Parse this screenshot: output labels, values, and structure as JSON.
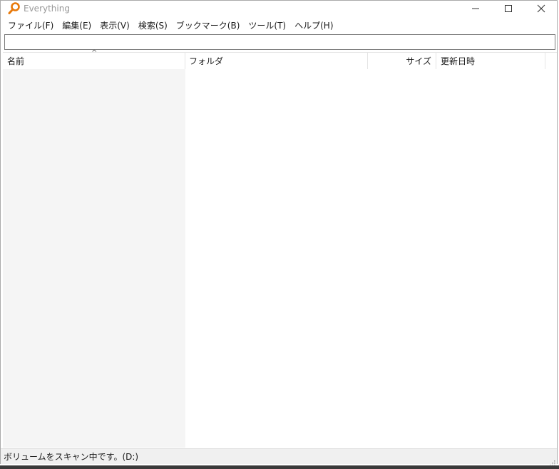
{
  "window": {
    "title": "Everything"
  },
  "menu": [
    {
      "label": "ファイル(F)"
    },
    {
      "label": "編集(E)"
    },
    {
      "label": "表示(V)"
    },
    {
      "label": "検索(S)"
    },
    {
      "label": "ブックマーク(B)"
    },
    {
      "label": "ツール(T)"
    },
    {
      "label": "ヘルプ(H)"
    }
  ],
  "search": {
    "value": "",
    "placeholder": ""
  },
  "columns": {
    "name": "名前",
    "folder": "フォルダ",
    "size": "サイズ",
    "date": "更新日時"
  },
  "status": {
    "text": "ボリュームをスキャン中です。(D:)"
  },
  "colors": {
    "accent": "#e8790a",
    "name_column_bg": "#f5f5f5"
  },
  "icons": {
    "app": "magnifier-icon",
    "minimize": "minimize-icon",
    "maximize": "maximize-icon",
    "close": "close-icon"
  }
}
